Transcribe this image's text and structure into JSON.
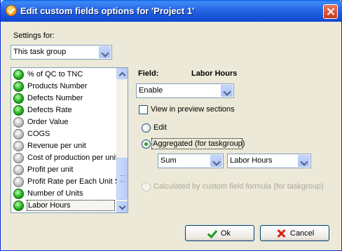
{
  "window": {
    "title": "Edit custom fields options for  'Project 1'"
  },
  "settings": {
    "label": "Settings for:",
    "selected": "This task group"
  },
  "fields": {
    "items": [
      {
        "label": "% of QC to TNC",
        "status": "green"
      },
      {
        "label": "Products Number",
        "status": "green"
      },
      {
        "label": "Defects Number",
        "status": "green"
      },
      {
        "label": "Defects Rate",
        "status": "green"
      },
      {
        "label": "Order Value",
        "status": "gray"
      },
      {
        "label": "COGS",
        "status": "gray"
      },
      {
        "label": "Revenue per unit",
        "status": "gray"
      },
      {
        "label": "Cost of production per unit",
        "status": "gray"
      },
      {
        "label": "Profit per unit",
        "status": "gray"
      },
      {
        "label": "Profit Rate per Each Unit Sold",
        "status": "gray"
      },
      {
        "label": "Number of Units",
        "status": "green"
      },
      {
        "label": "Labor Hours",
        "status": "green",
        "selected": true
      }
    ]
  },
  "detail": {
    "field_label": "Field:",
    "field_name": "Labor Hours",
    "enable_value": "Enable",
    "view_preview_label": "View in preview sections",
    "edit_label": "Edit",
    "aggregated_label": "Aggregated (for taskgroup)",
    "aggregate_function": "Sum",
    "aggregate_field": "Labor Hours",
    "formula_label": "Calculated by custom field formula (for taskgroup)"
  },
  "buttons": {
    "ok": "Ok",
    "cancel": "Cancel"
  }
}
